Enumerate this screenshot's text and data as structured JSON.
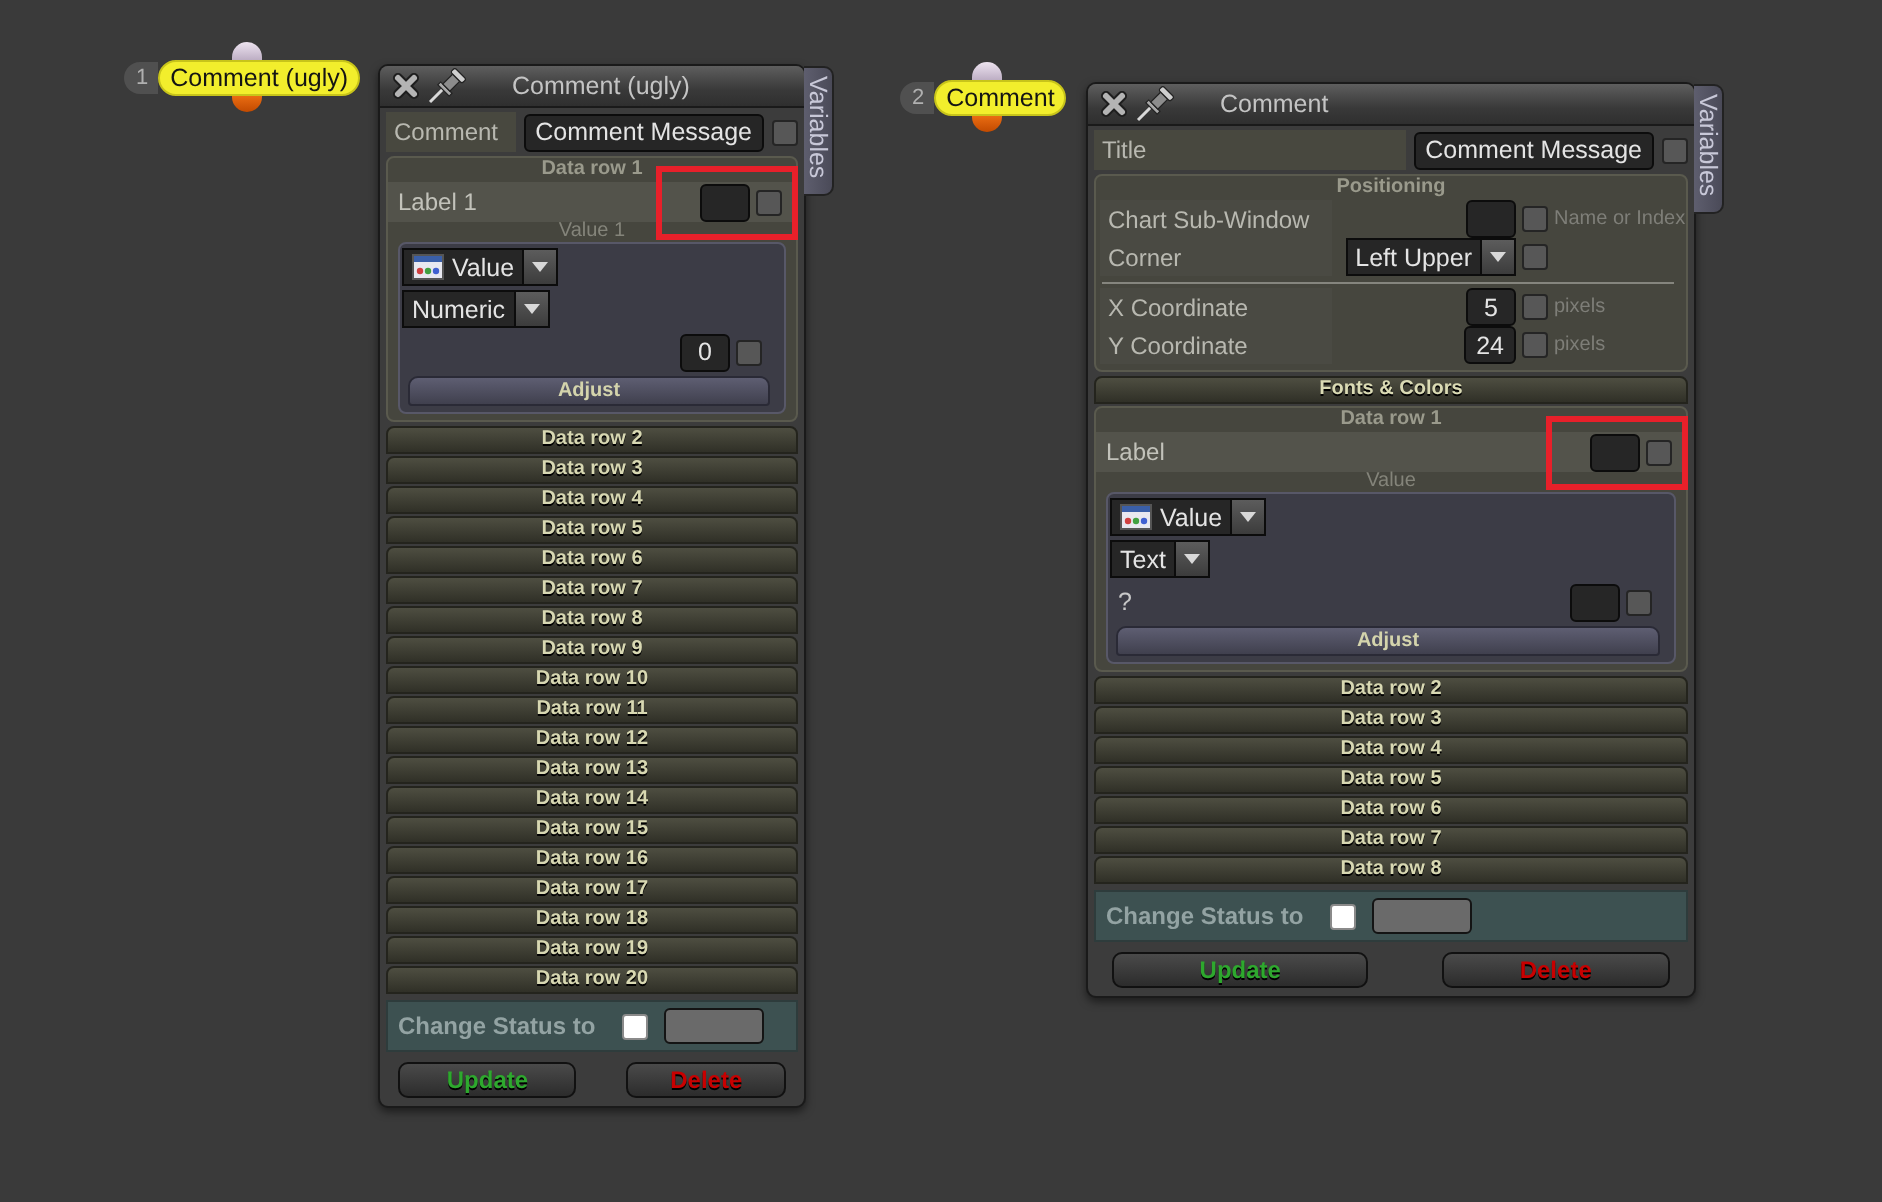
{
  "nodes": [
    {
      "number": "1",
      "label": "Comment (ugly)"
    },
    {
      "number": "2",
      "label": "Comment"
    }
  ],
  "panels": [
    {
      "title": "Comment (ugly)",
      "side_tab": "Variables",
      "top_row": {
        "label": "Comment",
        "value": "Comment Message",
        "checked": false
      },
      "groups": [
        {
          "kind": "data_row",
          "title": "Data row 1",
          "expanded": true,
          "label": "Label 1",
          "label_checked": false,
          "highlighted": true,
          "value_title": "Value 1",
          "source": "Value",
          "format": "Numeric",
          "amount": "0",
          "amount_checked": false,
          "button": "Adjust"
        },
        {
          "kind": "data_row",
          "title": "Data row 2",
          "expanded": false
        },
        {
          "kind": "data_row",
          "title": "Data row 3",
          "expanded": false
        },
        {
          "kind": "data_row",
          "title": "Data row 4",
          "expanded": false
        },
        {
          "kind": "data_row",
          "title": "Data row 5",
          "expanded": false
        },
        {
          "kind": "data_row",
          "title": "Data row 6",
          "expanded": false
        },
        {
          "kind": "data_row",
          "title": "Data row 7",
          "expanded": false
        },
        {
          "kind": "data_row",
          "title": "Data row 8",
          "expanded": false
        },
        {
          "kind": "data_row",
          "title": "Data row 9",
          "expanded": false
        },
        {
          "kind": "data_row",
          "title": "Data row 10",
          "expanded": false
        },
        {
          "kind": "data_row",
          "title": "Data row 11",
          "expanded": false
        },
        {
          "kind": "data_row",
          "title": "Data row 12",
          "expanded": false
        },
        {
          "kind": "data_row",
          "title": "Data row 13",
          "expanded": false
        },
        {
          "kind": "data_row",
          "title": "Data row 14",
          "expanded": false
        },
        {
          "kind": "data_row",
          "title": "Data row 15",
          "expanded": false
        },
        {
          "kind": "data_row",
          "title": "Data row 16",
          "expanded": false
        },
        {
          "kind": "data_row",
          "title": "Data row 17",
          "expanded": false
        },
        {
          "kind": "data_row",
          "title": "Data row 18",
          "expanded": false
        },
        {
          "kind": "data_row",
          "title": "Data row 19",
          "expanded": false
        },
        {
          "kind": "data_row",
          "title": "Data row 20",
          "expanded": false
        }
      ],
      "status": {
        "label": "Change Status to",
        "checked": false
      },
      "buttons": [
        {
          "kind": "update",
          "label": "Update"
        },
        {
          "kind": "delete",
          "label": "Delete"
        }
      ]
    },
    {
      "title": "Comment",
      "side_tab": "Variables",
      "top_row": {
        "label": "Title",
        "value": "Comment Message",
        "checked": false
      },
      "groups": [
        {
          "kind": "settings",
          "title": "Positioning",
          "expanded": true,
          "rows": [
            {
              "kind": "field",
              "label": "Chart Sub-Window",
              "checked": false,
              "hint": "Name or Index"
            },
            {
              "kind": "dropdown",
              "label": "Corner",
              "value": "Left Upper",
              "checked": false
            },
            {
              "kind": "divider"
            },
            {
              "kind": "field",
              "label": "X Coordinate",
              "value": "5",
              "checked": false,
              "hint": "pixels"
            },
            {
              "kind": "field",
              "label": "Y Coordinate",
              "value": "24",
              "checked": false,
              "hint": "pixels"
            }
          ]
        },
        {
          "kind": "settings",
          "title": "Fonts & Colors",
          "expanded": false
        },
        {
          "kind": "data_row",
          "title": "Data row 1",
          "expanded": true,
          "label": "Label",
          "label_checked": false,
          "highlighted": true,
          "value_title": "Value",
          "source": "Value",
          "format": "Text",
          "amount_label": "?",
          "amount_checked": false,
          "button": "Adjust"
        },
        {
          "kind": "data_row",
          "title": "Data row 2",
          "expanded": false
        },
        {
          "kind": "data_row",
          "title": "Data row 3",
          "expanded": false
        },
        {
          "kind": "data_row",
          "title": "Data row 4",
          "expanded": false
        },
        {
          "kind": "data_row",
          "title": "Data row 5",
          "expanded": false
        },
        {
          "kind": "data_row",
          "title": "Data row 6",
          "expanded": false
        },
        {
          "kind": "data_row",
          "title": "Data row 7",
          "expanded": false
        },
        {
          "kind": "data_row",
          "title": "Data row 8",
          "expanded": false
        }
      ],
      "status": {
        "label": "Change Status to",
        "checked": false
      },
      "buttons": [
        {
          "kind": "update",
          "label": "Update"
        },
        {
          "kind": "delete",
          "label": "Delete"
        }
      ]
    }
  ]
}
